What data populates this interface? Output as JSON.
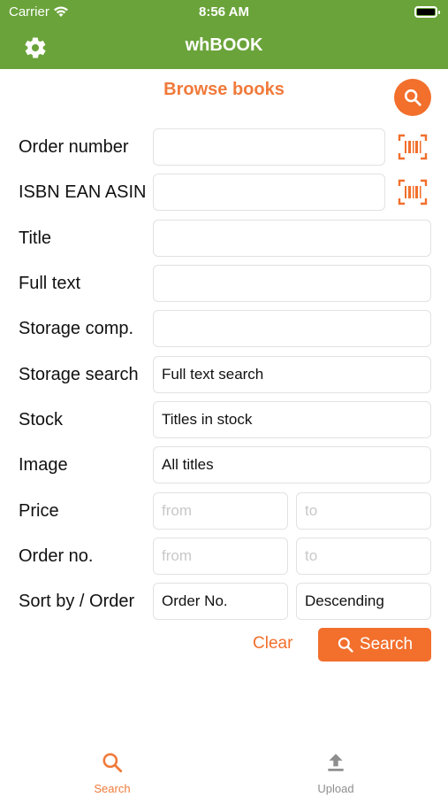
{
  "status_bar": {
    "carrier": "Carrier",
    "time": "8:56 AM"
  },
  "nav": {
    "title": "whBOOK",
    "settings_icon": "gear-icon"
  },
  "header": {
    "title": "Browse books",
    "search_icon": "search-icon"
  },
  "form": {
    "order_number": {
      "label": "Order number",
      "value": ""
    },
    "isbn": {
      "label": "ISBN EAN ASIN",
      "value": ""
    },
    "title": {
      "label": "Title",
      "value": ""
    },
    "full_text": {
      "label": "Full text",
      "value": ""
    },
    "storage_comp": {
      "label": "Storage comp.",
      "value": ""
    },
    "storage_search": {
      "label": "Storage search",
      "value": "Full text search"
    },
    "stock": {
      "label": "Stock",
      "value": "Titles in stock"
    },
    "image": {
      "label": "Image",
      "value": "All titles"
    },
    "price": {
      "label": "Price",
      "from_placeholder": "from",
      "to_placeholder": "to"
    },
    "order_no": {
      "label": "Order no.",
      "from_placeholder": "from",
      "to_placeholder": "to"
    },
    "sort": {
      "label": "Sort by / Order",
      "sort_value": "Order No.",
      "order_value": "Descending"
    }
  },
  "actions": {
    "clear_label": "Clear",
    "search_label": "Search"
  },
  "tabbar": {
    "tabs": [
      {
        "label": "Search",
        "icon": "search-icon",
        "active": true
      },
      {
        "label": "Upload",
        "icon": "upload-icon",
        "active": false
      }
    ]
  },
  "colors": {
    "nav_bg": "#6aa33a",
    "accent": "#f26f2c"
  }
}
